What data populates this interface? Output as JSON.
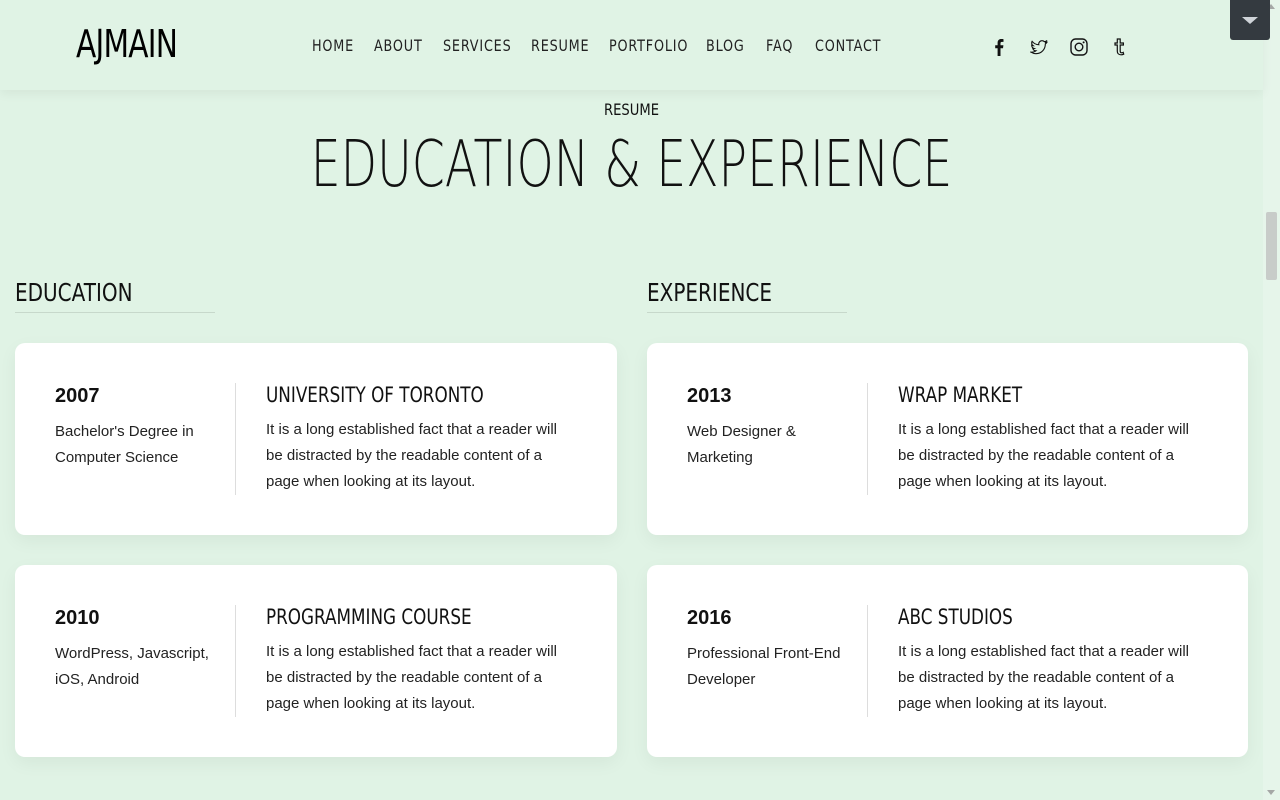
{
  "header": {
    "logo": "AJMAIN",
    "nav": [
      "HOME",
      "ABOUT",
      "SERVICES",
      "RESUME",
      "PORTFOLIO",
      "BLOG",
      "FAQ",
      "CONTACT"
    ],
    "social_icons": [
      "facebook-icon",
      "twitter-icon",
      "instagram-icon",
      "tumblr-icon"
    ]
  },
  "section": {
    "kicker": "RESUME",
    "heading": "EDUCATION & EXPERIENCE"
  },
  "education": {
    "title": "EDUCATION",
    "items": [
      {
        "year": "2007",
        "subtitle": "Bachelor's Degree in Computer Science",
        "title": "UNIVERSITY OF TORONTO",
        "desc": "It is a long established fact that a reader will be distracted by the readable content of a page when looking at its layout."
      },
      {
        "year": "2010",
        "subtitle": "WordPress, Javascript, iOS, Android",
        "title": "PROGRAMMING COURSE",
        "desc": "It is a long established fact that a reader will be distracted by the readable content of a page when looking at its layout."
      }
    ]
  },
  "experience": {
    "title": "EXPERIENCE",
    "items": [
      {
        "year": "2013",
        "subtitle": "Web Designer & Marketing",
        "title": "WRAP MARKET",
        "desc": "It is a long established fact that a reader will be distracted by the readable content of a page when looking at its layout."
      },
      {
        "year": "2016",
        "subtitle": "Professional Front-End Developer",
        "title": "ABC STUDIOS",
        "desc": "It is a long established fact that a reader will be distracted by the readable content of a page when looking at its layout."
      }
    ]
  },
  "colors": {
    "background": "#e0f3e5",
    "card": "#ffffff",
    "toggle": "#343a40"
  }
}
